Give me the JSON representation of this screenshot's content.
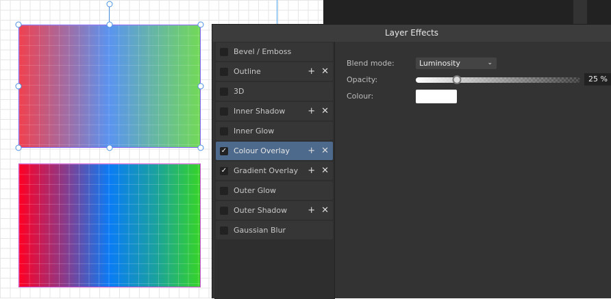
{
  "panel": {
    "title": "Layer Effects"
  },
  "effects": [
    {
      "label": "Bevel / Emboss",
      "checked": false,
      "actions": false
    },
    {
      "label": "Outline",
      "checked": false,
      "actions": true
    },
    {
      "label": "3D",
      "checked": false,
      "actions": false
    },
    {
      "label": "Inner Shadow",
      "checked": false,
      "actions": true
    },
    {
      "label": "Inner Glow",
      "checked": false,
      "actions": false
    },
    {
      "label": "Colour Overlay",
      "checked": true,
      "actions": true,
      "selected": true
    },
    {
      "label": "Gradient Overlay",
      "checked": true,
      "actions": true
    },
    {
      "label": "Outer Glow",
      "checked": false,
      "actions": false
    },
    {
      "label": "Outer Shadow",
      "checked": false,
      "actions": true
    },
    {
      "label": "Gaussian Blur",
      "checked": false,
      "actions": false
    }
  ],
  "settings": {
    "blend_label": "Blend mode:",
    "blend_value": "Luminosity",
    "opacity_label": "Opacity:",
    "opacity_value": "25 %",
    "opacity": 0.25,
    "colour_label": "Colour:",
    "colour": "#ffffff"
  },
  "icons": {
    "add": "+",
    "remove": "✕",
    "check": "✓",
    "chevron": "⌄"
  }
}
